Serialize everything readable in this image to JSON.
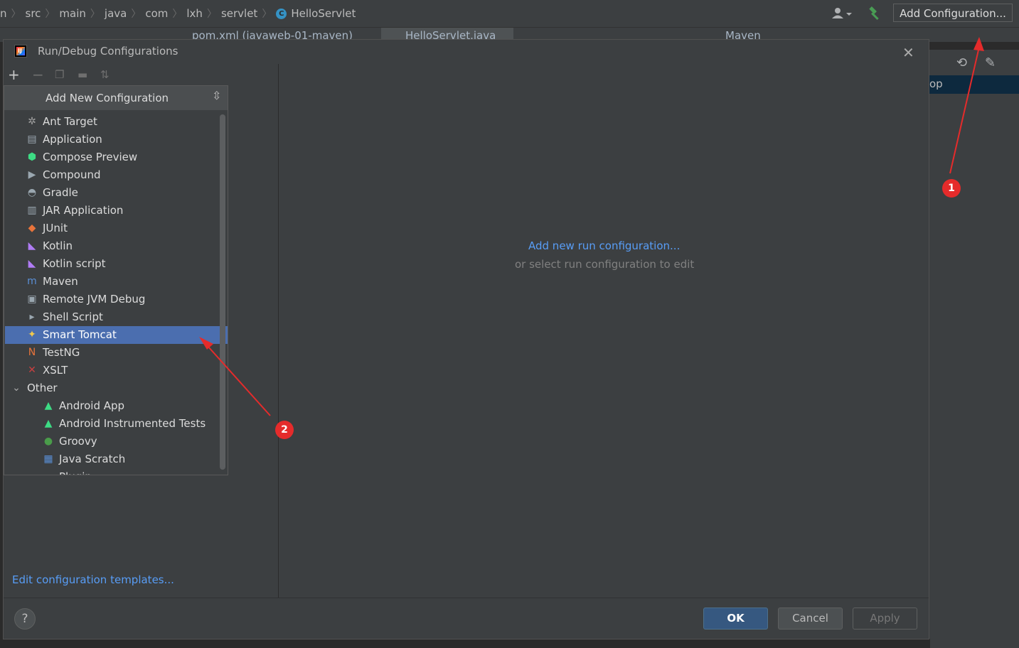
{
  "breadcrumb": {
    "items": [
      "n",
      "src",
      "main",
      "java",
      "com",
      "lxh",
      "servlet"
    ],
    "class_name": "HelloServlet",
    "class_icon_letter": "C"
  },
  "toolbar": {
    "add_config_label": "Add Configuration..."
  },
  "background_tabs": {
    "tab1": "pom.xml (javaweb-01-maven)",
    "tab2": "HelloServlet.java",
    "maven_panel": "Maven",
    "selected_fragment": "op"
  },
  "dialog": {
    "title": "Run/Debug Configurations",
    "popup_header": "Add New Configuration",
    "items": [
      {
        "label": "Ant Target",
        "icon": "ant-icon",
        "color": "#a0a0a0"
      },
      {
        "label": "Application",
        "icon": "application-icon",
        "color": "#9aa7b0"
      },
      {
        "label": "Compose Preview",
        "icon": "compose-icon",
        "color": "#3ddc84"
      },
      {
        "label": "Compound",
        "icon": "compound-icon",
        "color": "#9aa7b0"
      },
      {
        "label": "Gradle",
        "icon": "gradle-icon",
        "color": "#9aa7b0"
      },
      {
        "label": "JAR Application",
        "icon": "jar-icon",
        "color": "#9aa7b0"
      },
      {
        "label": "JUnit",
        "icon": "junit-icon",
        "color": "#e8743b"
      },
      {
        "label": "Kotlin",
        "icon": "kotlin-icon",
        "color": "#b07cf5"
      },
      {
        "label": "Kotlin script",
        "icon": "kotlin-script-icon",
        "color": "#b07cf5"
      },
      {
        "label": "Maven",
        "icon": "maven-icon",
        "color": "#5a8fd6"
      },
      {
        "label": "Remote JVM Debug",
        "icon": "remote-debug-icon",
        "color": "#9aa7b0"
      },
      {
        "label": "Shell Script",
        "icon": "shell-script-icon",
        "color": "#9aa7b0"
      },
      {
        "label": "Smart Tomcat",
        "icon": "tomcat-icon",
        "color": "#f2c94c",
        "selected": true
      },
      {
        "label": "TestNG",
        "icon": "testng-icon",
        "color": "#e8743b"
      },
      {
        "label": "XSLT",
        "icon": "xslt-icon",
        "color": "#c94040"
      }
    ],
    "other_group": {
      "label": "Other",
      "items": [
        {
          "label": "Android App",
          "icon": "android-icon",
          "color": "#3ddc84"
        },
        {
          "label": "Android Instrumented Tests",
          "icon": "android-test-icon",
          "color": "#3ddc84"
        },
        {
          "label": "Groovy",
          "icon": "groovy-icon",
          "color": "#4a9c4a"
        },
        {
          "label": "Java Scratch",
          "icon": "java-scratch-icon",
          "color": "#5a8fd6"
        },
        {
          "label": "Plugin",
          "icon": "plugin-icon",
          "color": "#9aa7b0"
        }
      ]
    },
    "right_link": "Add new run configuration...",
    "right_hint": "or select run configuration to edit",
    "templates_link": "Edit configuration templates...",
    "help_label": "?",
    "ok_label": "OK",
    "cancel_label": "Cancel",
    "apply_label": "Apply"
  },
  "annotations": {
    "marker1": "1",
    "marker2": "2",
    "color": "#e52b2b"
  }
}
